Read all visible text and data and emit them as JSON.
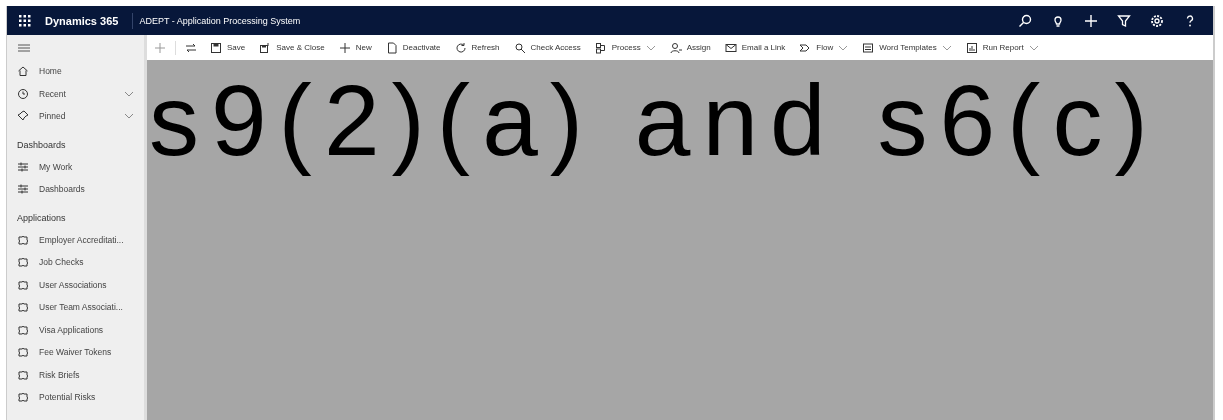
{
  "top_bar": {
    "app_name": "Dynamics 365",
    "title": "ADEPT - Application Processing System"
  },
  "toolbar": {
    "items": [
      {
        "label": "Save",
        "has_menu": false
      },
      {
        "label": "Save & Close",
        "has_menu": false
      },
      {
        "label": "New",
        "has_menu": false
      },
      {
        "label": "Deactivate",
        "has_menu": false
      },
      {
        "label": "Refresh",
        "has_menu": false
      },
      {
        "label": "Check Access",
        "has_menu": false
      },
      {
        "label": "Process",
        "has_menu": true
      },
      {
        "label": "Assign",
        "has_menu": false
      },
      {
        "label": "Email a Link",
        "has_menu": false
      },
      {
        "label": "Flow",
        "has_menu": true
      },
      {
        "label": "Word Templates",
        "has_menu": true
      },
      {
        "label": "Run Report",
        "has_menu": true
      }
    ]
  },
  "sidebar": {
    "groups": [
      {
        "items": [
          {
            "label": "Home",
            "expandable": false
          },
          {
            "label": "Recent",
            "expandable": true
          },
          {
            "label": "Pinned",
            "expandable": true
          }
        ]
      },
      {
        "heading": "Dashboards",
        "items": [
          {
            "label": "My Work",
            "expandable": false
          },
          {
            "label": "Dashboards",
            "expandable": false
          }
        ]
      },
      {
        "heading": "Applications",
        "items": [
          {
            "label": "Employer Accreditati...",
            "expandable": false
          },
          {
            "label": "Job Checks",
            "expandable": false
          },
          {
            "label": "User Associations",
            "expandable": false
          },
          {
            "label": "User Team Associati...",
            "expandable": false
          },
          {
            "label": "Visa Applications",
            "expandable": false
          },
          {
            "label": "Fee Waiver Tokens",
            "expandable": false
          },
          {
            "label": "Risk Briefs",
            "expandable": false
          },
          {
            "label": "Potential Risks",
            "expandable": false
          }
        ]
      }
    ]
  },
  "content": {
    "redaction_label": "s9(2)(a) and s6(c)"
  }
}
